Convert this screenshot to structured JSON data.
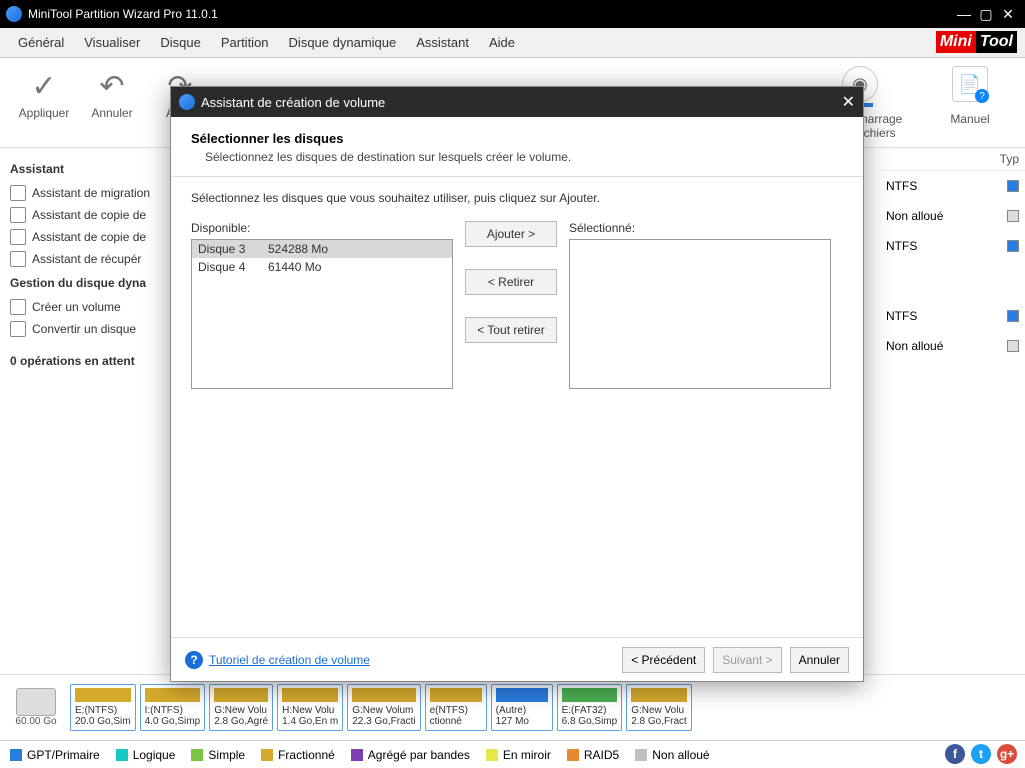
{
  "titlebar": {
    "title": "MiniTool Partition Wizard Pro 11.0.1"
  },
  "menubar": {
    "items": [
      "Général",
      "Visualiser",
      "Disque",
      "Partition",
      "Disque dynamique",
      "Assistant",
      "Aide"
    ]
  },
  "logo": {
    "left": "Mini",
    "right": "Tool"
  },
  "toolbar": {
    "apply": "Appliquer",
    "undo": "Annuler",
    "redo": "Annu",
    "boot": "e de démarrage",
    "fs": "ne de fichiers",
    "manual": "Manuel"
  },
  "sidebar": {
    "h1": "Assistant",
    "items1": [
      "Assistant de migration",
      "Assistant de copie de",
      "Assistant de copie de",
      "Assistant de récupér"
    ],
    "h2": "Gestion du disque dyna",
    "items2": [
      "Créer un volume",
      "Convertir un disque"
    ],
    "h3": "0 opérations en attent"
  },
  "right": {
    "hdr2": "Typ",
    "rows": [
      "NTFS",
      "Non alloué",
      "NTFS",
      "NTFS",
      "Non alloué"
    ]
  },
  "diskmap": {
    "disk_size": "60.00 Go",
    "segments": [
      {
        "top": "E:(NTFS)",
        "bottom": "20.0 Go,Sim",
        "c": "gold"
      },
      {
        "top": "I:(NTFS)",
        "bottom": "4.0 Go,Simp",
        "c": "gold"
      },
      {
        "top": "G:New Volu",
        "bottom": "2.8 Go,Agré",
        "c": "gold"
      },
      {
        "top": "H:New Volu",
        "bottom": "1.4 Go,En m",
        "c": "gold"
      },
      {
        "top": "G:New Volum",
        "bottom": "22.3 Go,Fracti",
        "c": "gold"
      },
      {
        "top": "e(NTFS)",
        "bottom": "ctionné",
        "c": "gold"
      },
      {
        "top": "(Autre)",
        "bottom": "127 Mo",
        "c": "sblue"
      },
      {
        "top": "E:(FAT32)",
        "bottom": "6.8 Go,Simp",
        "c": "green"
      },
      {
        "top": "G:New Volu",
        "bottom": "2.8 Go,Fract",
        "c": "gold"
      }
    ]
  },
  "legend": {
    "items": [
      {
        "label": "GPT/Primaire",
        "color": "#2a7de1"
      },
      {
        "label": "Logique",
        "color": "#17c9c0"
      },
      {
        "label": "Simple",
        "color": "#7cc243"
      },
      {
        "label": "Fractionné",
        "color": "#d4a92c"
      },
      {
        "label": "Agrégé par bandes",
        "color": "#7d3fb3"
      },
      {
        "label": "En miroir",
        "color": "#e6e64d"
      },
      {
        "label": "RAID5",
        "color": "#e68a2e"
      },
      {
        "label": "Non alloué",
        "color": "#bfbfbf"
      }
    ]
  },
  "dialog": {
    "title": "Assistant de création de volume",
    "heading": "Sélectionner les disques",
    "subheading": "Sélectionnez les disques de destination sur lesquels créer le volume.",
    "instruction": "Sélectionnez les disques que vous souhaitez utiliser, puis cliquez sur Ajouter.",
    "available_label": "Disponible:",
    "selected_label": "Sélectionné:",
    "available": [
      {
        "name": "Disque 3",
        "size": "524288 Mo",
        "selected": true
      },
      {
        "name": "Disque 4",
        "size": "61440 Mo",
        "selected": false
      }
    ],
    "btn_add": "Ajouter  >",
    "btn_remove": "<  Retirer",
    "btn_remove_all": "<  Tout retirer",
    "help_link": "Tutoriel de création de volume",
    "btn_prev": "<  Précédent",
    "btn_next": "Suivant  >",
    "btn_cancel": "Annuler"
  }
}
